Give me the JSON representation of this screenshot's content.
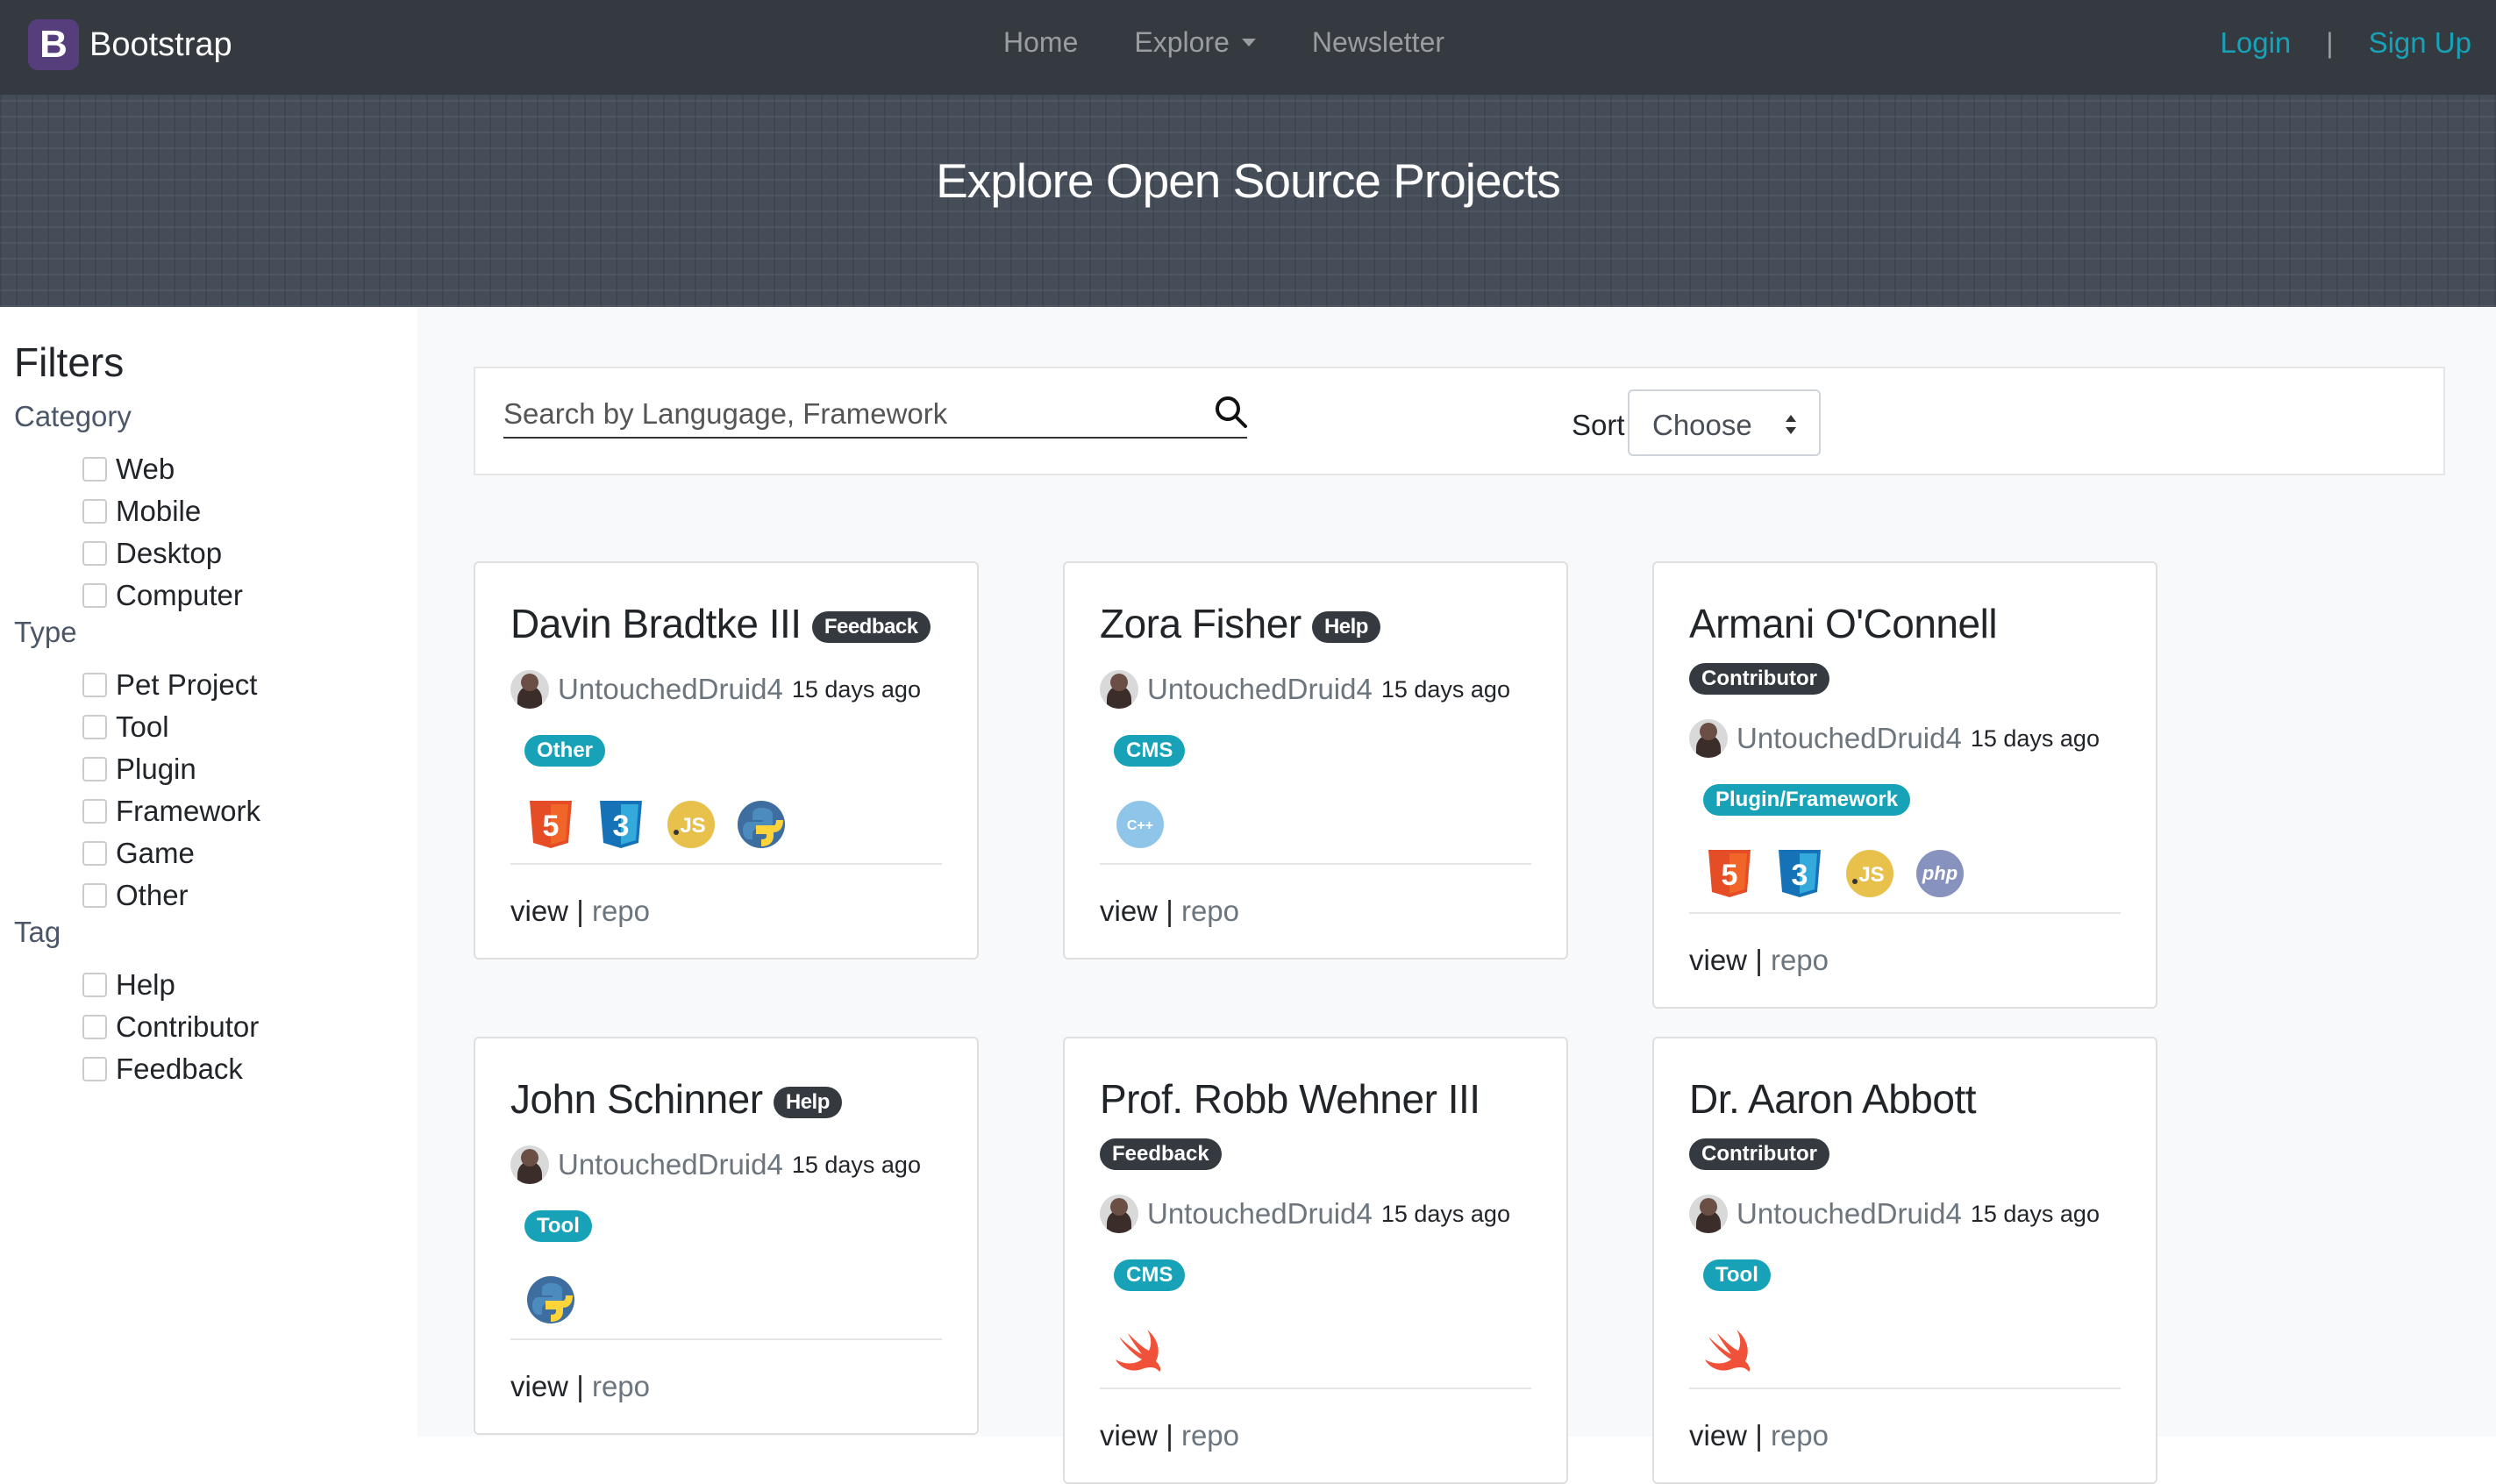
{
  "navbar": {
    "brand_letter": "B",
    "brand_name": "Bootstrap",
    "links": [
      "Home",
      "Explore",
      "Newsletter"
    ],
    "login": "Login",
    "separator": "|",
    "signup": "Sign Up"
  },
  "hero": {
    "title": "Explore Open Source Projects"
  },
  "filters": {
    "title": "Filters",
    "category": {
      "title": "Category",
      "options": [
        "Web",
        "Mobile",
        "Desktop",
        "Computer"
      ]
    },
    "type": {
      "title": "Type",
      "options": [
        "Pet Project",
        "Tool",
        "Plugin",
        "Framework",
        "Game",
        "Other"
      ]
    },
    "tag": {
      "title": "Tag",
      "options": [
        "Help",
        "Contributor",
        "Feedback"
      ]
    }
  },
  "search": {
    "placeholder": "Search by Langugage, Framework"
  },
  "sort": {
    "label": "Sort",
    "value": "Choose"
  },
  "cards": [
    {
      "title": "Davin Bradtke III",
      "tag": "Feedback",
      "author": "UntouchedDruid4",
      "time": "15 days ago",
      "type": "Other",
      "icons": [
        "html5-icon",
        "css3-icon",
        "javascript-icon",
        "python-icon"
      ],
      "view": "view",
      "sep": "|",
      "repo": "repo"
    },
    {
      "title": "Zora Fisher",
      "tag": "Help",
      "author": "UntouchedDruid4",
      "time": "15 days ago",
      "type": "CMS",
      "icons": [
        "cpp-icon"
      ],
      "view": "view",
      "sep": "|",
      "repo": "repo"
    },
    {
      "title": "Armani O'Connell",
      "tag": "Contributor",
      "author": "UntouchedDruid4",
      "time": "15 days ago",
      "type": "Plugin/Framework",
      "icons": [
        "html5-icon",
        "css3-icon",
        "javascript-icon",
        "php-icon"
      ],
      "view": "view",
      "sep": "|",
      "repo": "repo"
    },
    {
      "title": "John Schinner",
      "tag": "Help",
      "author": "UntouchedDruid4",
      "time": "15 days ago",
      "type": "Tool",
      "icons": [
        "python-icon"
      ],
      "view": "view",
      "sep": "|",
      "repo": "repo"
    },
    {
      "title": "Prof. Robb Wehner III",
      "tag": "Feedback",
      "author": "UntouchedDruid4",
      "time": "15 days ago",
      "type": "CMS",
      "icons": [
        "swift-icon"
      ],
      "view": "view",
      "sep": "|",
      "repo": "repo"
    },
    {
      "title": "Dr. Aaron Abbott",
      "tag": "Contributor",
      "author": "UntouchedDruid4",
      "time": "15 days ago",
      "type": "Tool",
      "icons": [
        "swift-icon"
      ],
      "view": "view",
      "sep": "|",
      "repo": "repo"
    }
  ],
  "colors": {
    "navbar": "#343a40",
    "accent": "#17a2b8",
    "brand": "#563d7c",
    "badge_dark": "#343a40"
  }
}
